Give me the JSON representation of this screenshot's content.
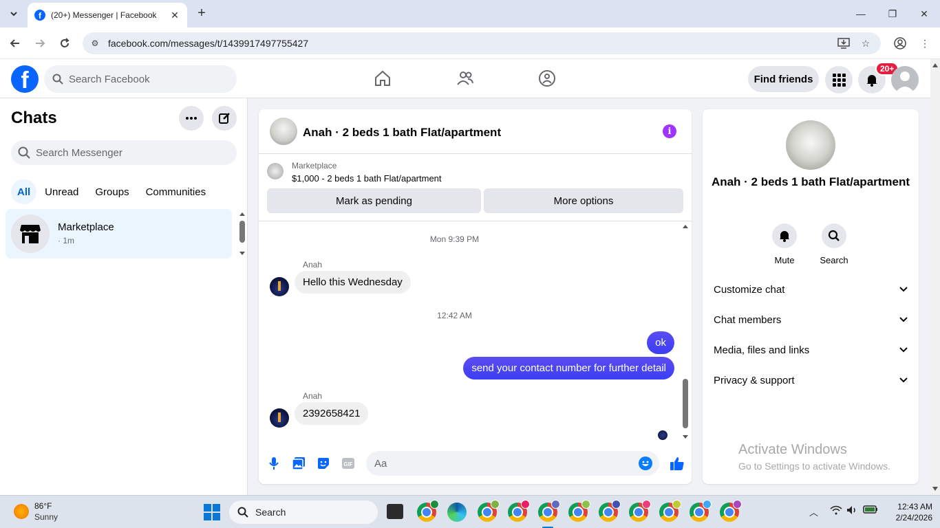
{
  "browser": {
    "tab_title": "(20+) Messenger | Facebook",
    "url": "facebook.com/messages/t/1439917497755427"
  },
  "fbnav": {
    "search_placeholder": "Search Facebook",
    "find_friends": "Find friends",
    "notif_badge": "20+"
  },
  "left": {
    "title": "Chats",
    "search_placeholder": "Search Messenger",
    "filters": [
      "All",
      "Unread",
      "Groups",
      "Communities"
    ],
    "active_filter": "All",
    "chats": [
      {
        "name": "Marketplace",
        "meta": "· 1m"
      }
    ]
  },
  "conversation": {
    "title": "Anah · 2 beds 1 bath Flat/apartment",
    "marketplace_label": "Marketplace",
    "listing": "$1,000 - 2 beds 1 bath Flat/apartment",
    "mark_pending": "Mark as pending",
    "more_options": "More options",
    "messages": [
      {
        "type": "timestamp",
        "text": "Mon 9:39 PM"
      },
      {
        "type": "in",
        "sender": "Anah",
        "text": "Hello this Wednesday"
      },
      {
        "type": "timestamp",
        "text": "12:42 AM"
      },
      {
        "type": "out",
        "text": "ok"
      },
      {
        "type": "out",
        "text": "send your contact number for further detail"
      },
      {
        "type": "in",
        "sender": "Anah",
        "text": "2392658421"
      }
    ],
    "composer_placeholder": "Aa"
  },
  "right": {
    "name": "Anah · 2 beds 1 bath Flat/apartment",
    "actions": [
      "Mute",
      "Search"
    ],
    "sections": [
      "Customize chat",
      "Chat members",
      "Media, files and links",
      "Privacy & support"
    ],
    "watermark_title": "Activate Windows",
    "watermark_sub": "Go to Settings to activate Windows."
  },
  "taskbar": {
    "temp": "86°F",
    "condition": "Sunny",
    "search_placeholder": "Search",
    "time": "12:43 AM",
    "date": "2/24/2026"
  },
  "colors": {
    "fb_blue": "#0866ff",
    "outgoing_bubble": "#4a43ec",
    "info_purple": "#a033ff",
    "badge_red": "#e41e3f"
  }
}
